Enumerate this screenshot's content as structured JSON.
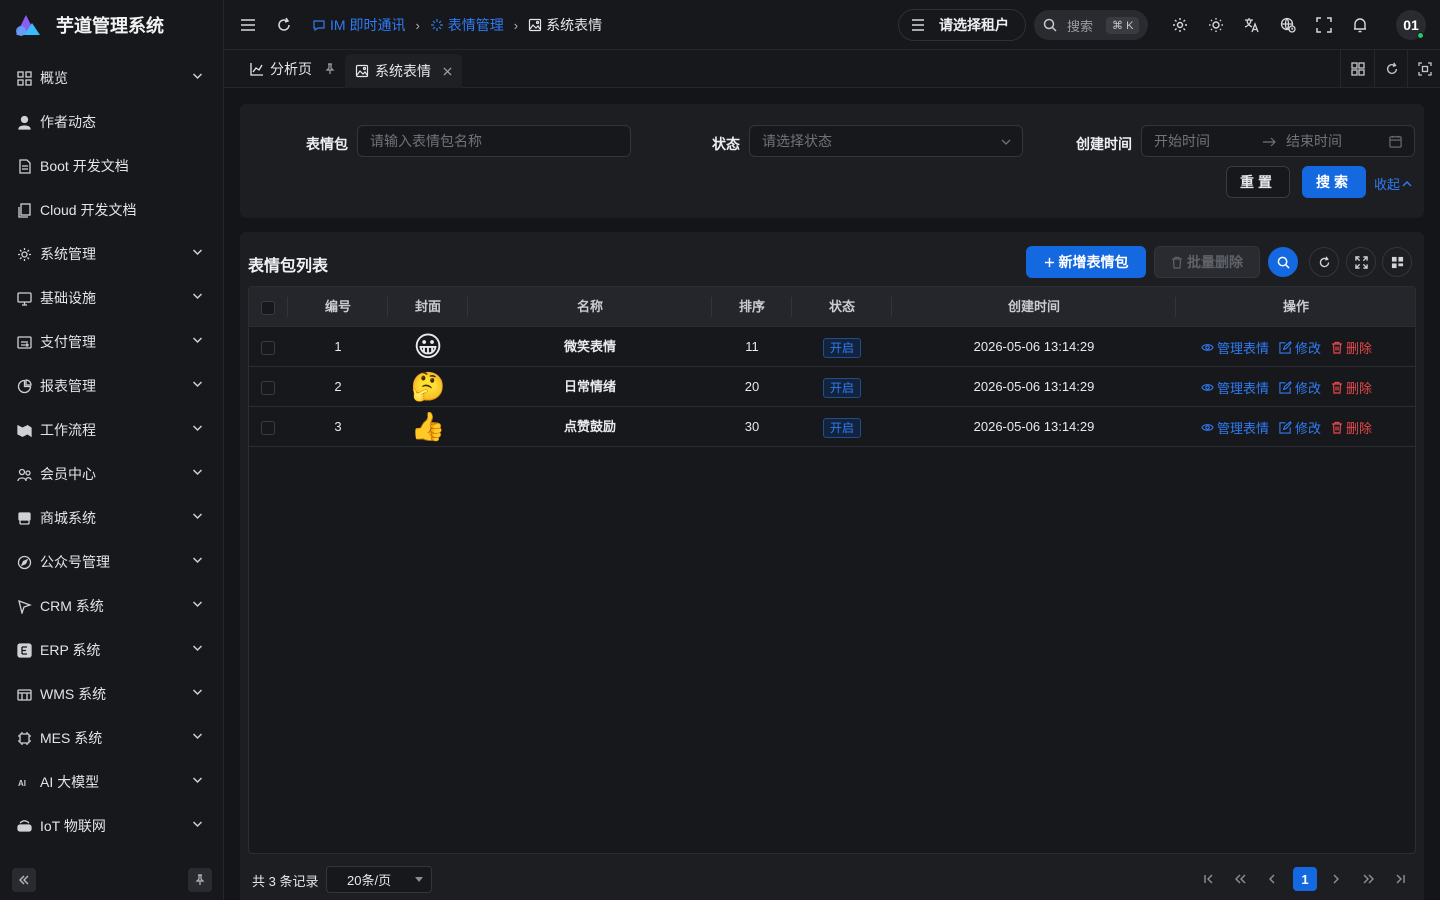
{
  "app": {
    "title": "芋道管理系统"
  },
  "sidebar": {
    "items": [
      {
        "label": "概览",
        "icon": "dashboard-icon",
        "expandable": true
      },
      {
        "label": "作者动态",
        "icon": "user-icon",
        "expandable": false
      },
      {
        "label": "Boot 开发文档",
        "icon": "document-icon",
        "expandable": false
      },
      {
        "label": "Cloud 开发文档",
        "icon": "copy-document-icon",
        "expandable": false
      },
      {
        "label": "系统管理",
        "icon": "gear-icon",
        "expandable": true
      },
      {
        "label": "基础设施",
        "icon": "monitor-icon",
        "expandable": true
      },
      {
        "label": "支付管理",
        "icon": "payment-icon",
        "expandable": true
      },
      {
        "label": "报表管理",
        "icon": "pie-chart-icon",
        "expandable": true
      },
      {
        "label": "工作流程",
        "icon": "workflow-icon",
        "expandable": true
      },
      {
        "label": "会员中心",
        "icon": "members-icon",
        "expandable": true
      },
      {
        "label": "商城系统",
        "icon": "shop-icon",
        "expandable": true
      },
      {
        "label": "公众号管理",
        "icon": "compass-icon",
        "expandable": true
      },
      {
        "label": "CRM 系统",
        "icon": "crm-icon",
        "expandable": true
      },
      {
        "label": "ERP 系统",
        "icon": "erp-icon",
        "expandable": true
      },
      {
        "label": "WMS 系统",
        "icon": "warehouse-icon",
        "expandable": true
      },
      {
        "label": "MES 系统",
        "icon": "chip-icon",
        "expandable": true
      },
      {
        "label": "AI 大模型",
        "icon": "ai-icon",
        "expandable": true
      },
      {
        "label": "IoT 物联网",
        "icon": "iot-icon",
        "expandable": true
      }
    ]
  },
  "header": {
    "breadcrumb": [
      {
        "label": "IM 即时通讯",
        "type": "link",
        "icon": "chat-icon"
      },
      {
        "label": "表情管理",
        "type": "link",
        "icon": "sparkle-icon"
      },
      {
        "label": "系统表情",
        "type": "current",
        "icon": "image-icon"
      }
    ],
    "tenant_label": "请选择租户",
    "search_label": "搜索",
    "search_shortcut": "⌘ K",
    "avatar_text": "01"
  },
  "tabs": [
    {
      "label": "分析页",
      "icon": "chart-icon",
      "tail": "pin"
    },
    {
      "label": "系统表情",
      "icon": "image-icon",
      "tail": "close",
      "active": true
    }
  ],
  "filter": {
    "pack_label": "表情包",
    "pack_placeholder": "请输入表情包名称",
    "status_label": "状态",
    "status_placeholder": "请选择状态",
    "created_label": "创建时间",
    "start_placeholder": "开始时间",
    "end_placeholder": "结束时间",
    "reset_label": "重置",
    "search_label": "搜索",
    "collapse_label": "收起"
  },
  "list": {
    "title": "表情包列表",
    "add_label": "新增表情包",
    "batch_delete_label": "批量删除",
    "columns": [
      "编号",
      "封面",
      "名称",
      "排序",
      "状态",
      "创建时间",
      "操作"
    ],
    "rows": [
      {
        "id": "1",
        "cover": "😀",
        "name": "微笑表情",
        "sort": "11",
        "status": "开启",
        "created": "2026-05-06 13:14:29"
      },
      {
        "id": "2",
        "cover": "🤔",
        "name": "日常情绪",
        "sort": "20",
        "status": "开启",
        "created": "2026-05-06 13:14:29"
      },
      {
        "id": "3",
        "cover": "👍",
        "name": "点赞鼓励",
        "sort": "30",
        "status": "开启",
        "created": "2026-05-06 13:14:29"
      }
    ],
    "actions": {
      "manage": "管理表情",
      "edit": "修改",
      "delete": "删除"
    }
  },
  "pager": {
    "total_text": "共 3 条记录",
    "page_size": "20条/页",
    "current_page": "1"
  },
  "colors": {
    "accent": "#1468e0",
    "link": "#2f7bf5",
    "danger": "#e5484d",
    "background": "#141518",
    "panel": "#1d1e22"
  }
}
